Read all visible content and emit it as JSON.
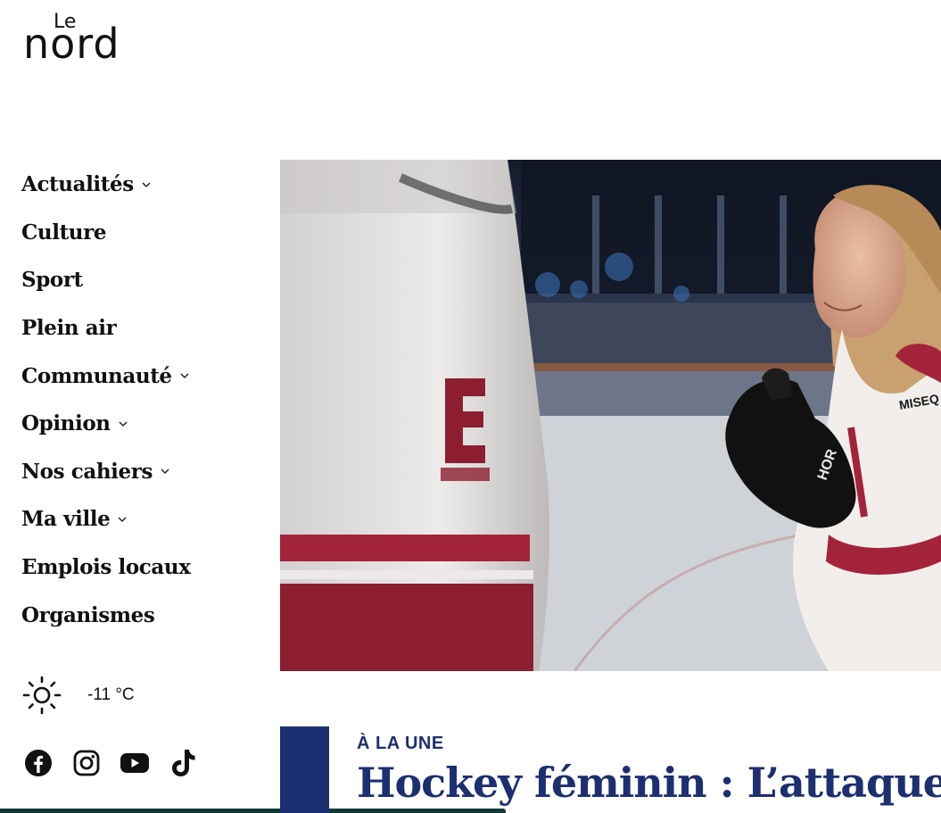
{
  "site": {
    "logo_top": "Le",
    "logo_main": "nord"
  },
  "nav": {
    "items": [
      {
        "label": "Actualités",
        "has_dropdown": true
      },
      {
        "label": "Culture",
        "has_dropdown": false
      },
      {
        "label": "Sport",
        "has_dropdown": false
      },
      {
        "label": "Plein air",
        "has_dropdown": false
      },
      {
        "label": "Communauté",
        "has_dropdown": true
      },
      {
        "label": "Opinion",
        "has_dropdown": true
      },
      {
        "label": "Nos cahiers",
        "has_dropdown": true
      },
      {
        "label": "Ma ville",
        "has_dropdown": true
      },
      {
        "label": "Emplois locaux",
        "has_dropdown": false
      },
      {
        "label": "Organismes",
        "has_dropdown": false
      }
    ]
  },
  "weather": {
    "icon": "sun-icon",
    "temperature": "-11 °C"
  },
  "socials": [
    "facebook-icon",
    "instagram-icon",
    "youtube-icon",
    "tiktok-icon"
  ],
  "feature": {
    "kicker": "À LA UNE",
    "headline": "Hockey féminin : L’attaque de"
  },
  "colors": {
    "brand_navy": "#1c2f70",
    "bottom_bar": "#0e3b36",
    "text": "#111111"
  }
}
